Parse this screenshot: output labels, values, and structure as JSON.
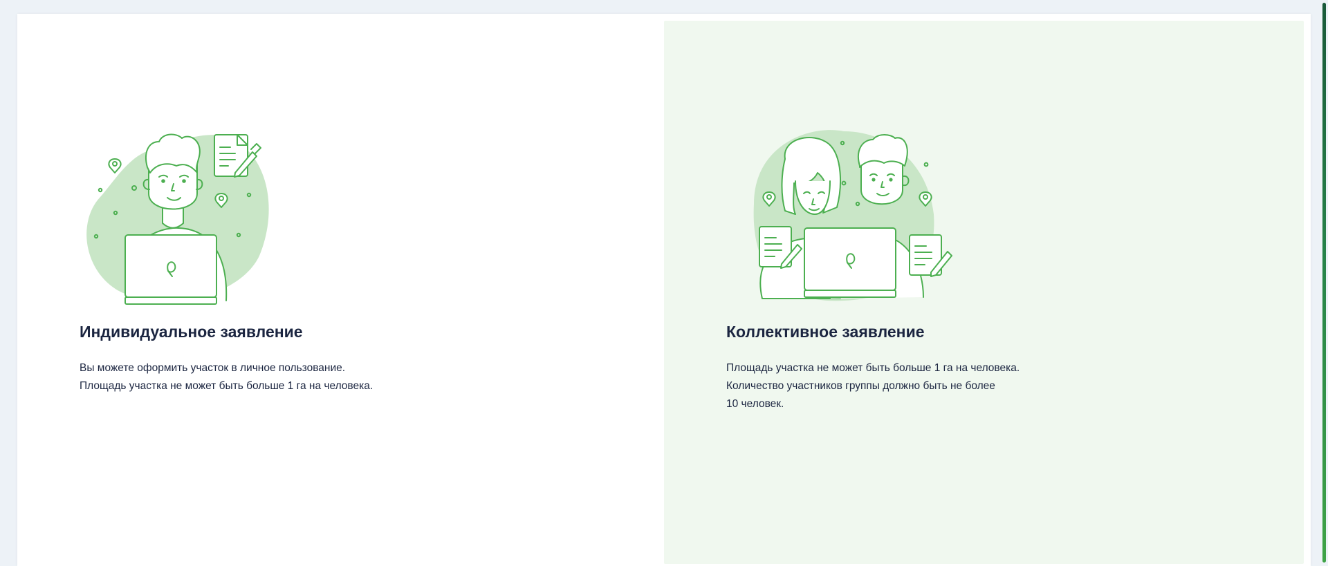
{
  "cards": [
    {
      "title": "Индивидуальное заявление",
      "lines": [
        "Вы можете оформить участок в личное пользование.",
        "Площадь участка не может быть больше 1 га на человека."
      ]
    },
    {
      "title": "Коллективное заявление",
      "lines": [
        "Площадь участка не может быть больше 1 га на человека.",
        "Количество участников группы должно быть не более",
        "10 человек."
      ]
    }
  ],
  "colors": {
    "accent": "#4caf50",
    "accent_light": "#c9e6c7",
    "selected_bg": "#f0f8ef",
    "text": "#1b2540",
    "scroll_thumb": "#27834a"
  }
}
